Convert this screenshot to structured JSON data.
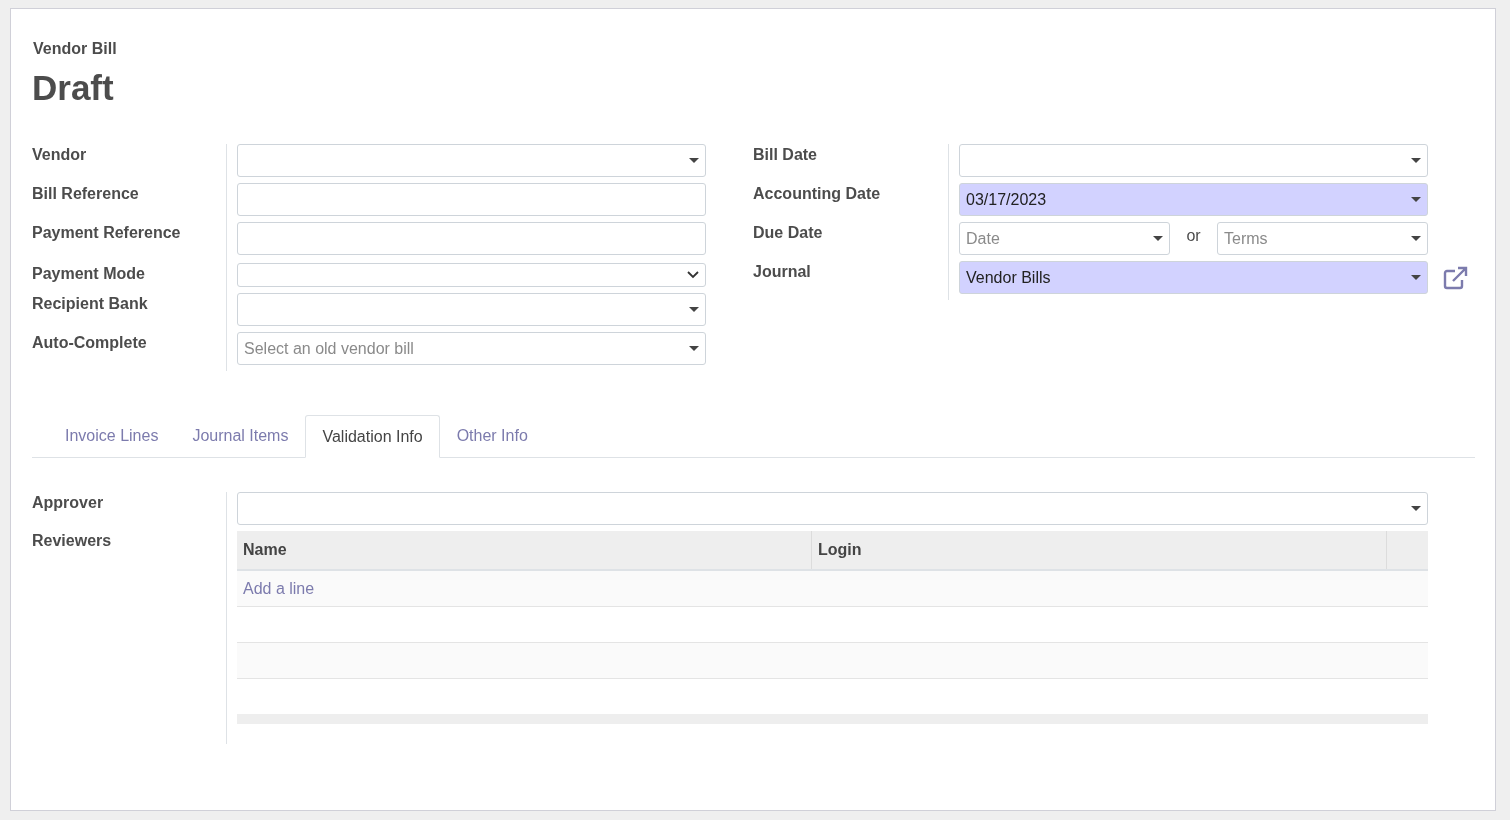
{
  "header": {
    "subtitle": "Vendor Bill",
    "title": "Draft"
  },
  "left_fields": [
    {
      "label": "Vendor",
      "kind": "many2one",
      "required": false
    },
    {
      "label": "Bill Reference",
      "kind": "text",
      "required": false
    },
    {
      "label": "Payment Reference",
      "kind": "text",
      "required": false
    },
    {
      "label": "Payment Mode",
      "kind": "select",
      "required": false
    },
    {
      "label": "Recipient Bank",
      "kind": "many2one",
      "required": false
    },
    {
      "label": "Auto-Complete",
      "kind": "many2one",
      "required": false,
      "placeholder": "Select an old vendor bill"
    }
  ],
  "right_fields": [
    {
      "label": "Bill Date",
      "kind": "many2one",
      "required": false,
      "external_link": false
    },
    {
      "label": "Accounting Date",
      "kind": "many2one",
      "required": true,
      "value": "03/17/2023",
      "external_link": false
    },
    {
      "label": "Due Date",
      "kind": "due_date",
      "required": false,
      "date_placeholder": "Date",
      "separator": "or",
      "terms_placeholder": "Terms",
      "external_link": false
    },
    {
      "label": "Journal",
      "kind": "many2one",
      "required": true,
      "value": "Vendor Bills",
      "external_link": true
    }
  ],
  "tabs": [
    {
      "label": "Invoice Lines",
      "selected": false
    },
    {
      "label": "Journal Items",
      "selected": false
    },
    {
      "label": "Validation Info",
      "selected": true
    },
    {
      "label": "Other Info",
      "selected": false
    }
  ],
  "validation": {
    "approver": {
      "label": "Approver",
      "kind": "many2one",
      "required": false
    },
    "reviewers": {
      "label": "Reviewers",
      "columns": [
        "Name",
        "Login"
      ],
      "add_line": "Add a line"
    }
  }
}
